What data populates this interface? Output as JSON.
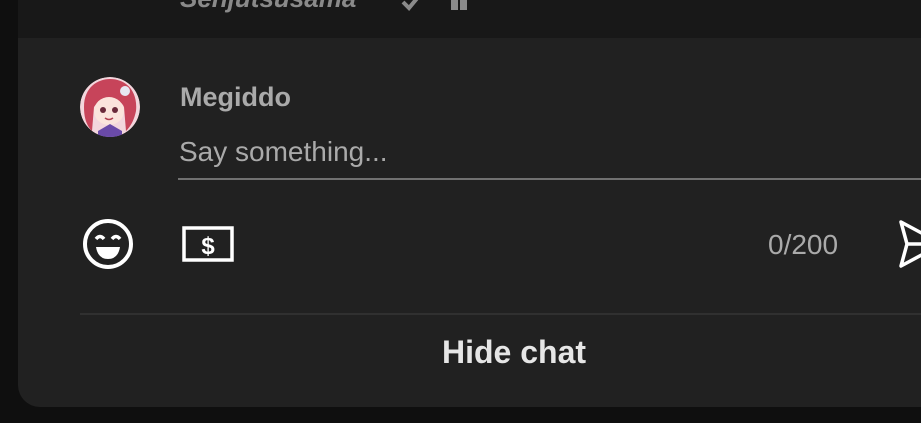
{
  "header": {
    "previous_author": "Senjutsusama"
  },
  "composer": {
    "author_name": "Megiddo",
    "placeholder": "Say something...",
    "char_count": "0/200",
    "icons": {
      "emoji": "smiley-face-icon",
      "super_chat": "dollar-bill-icon",
      "send": "send-arrow-icon",
      "verified": "checkmark-icon",
      "moderator": "wrench-icon"
    }
  },
  "footer": {
    "hide_chat_label": "Hide chat"
  },
  "colors": {
    "panel_bg": "#212121",
    "page_bg": "#0f0f0f",
    "secondary_text": "#aaaaaa",
    "primary_text": "#e6e6e6"
  }
}
